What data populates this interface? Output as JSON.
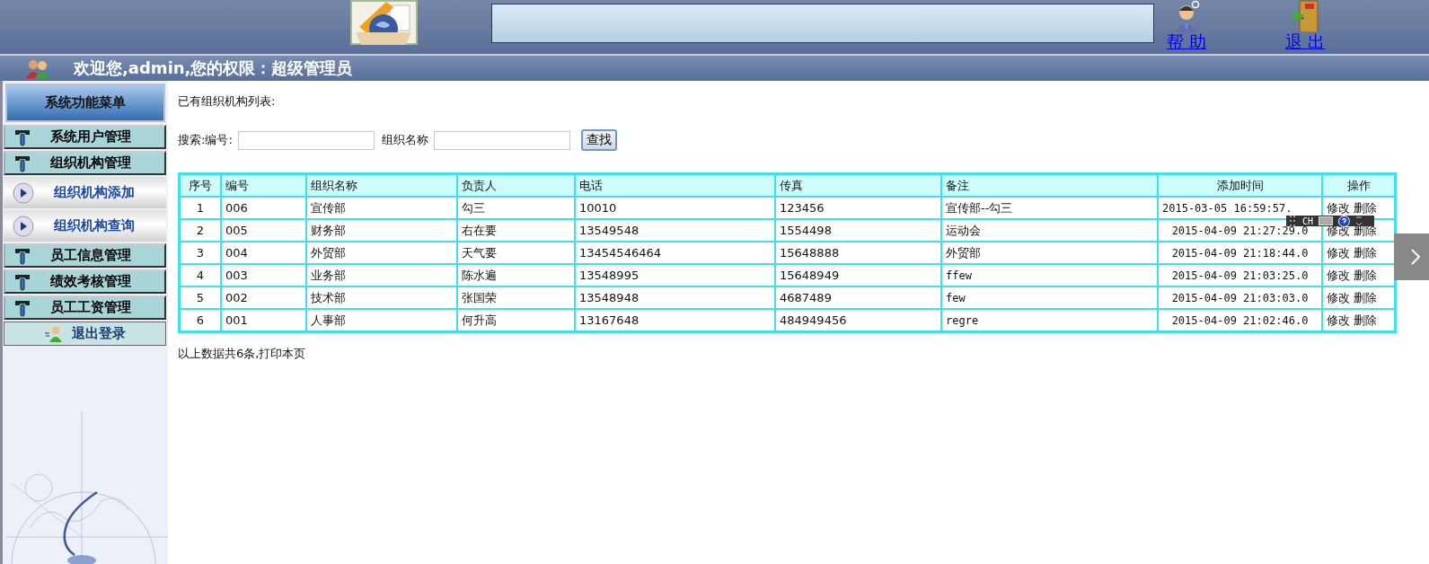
{
  "header": {
    "help_link": "帮 助",
    "exit_link": "退 出"
  },
  "welcome": "欢迎您,admin,您的权限：超级管理员",
  "sidebar": {
    "title": "系统功能菜单",
    "items": [
      {
        "label": "系统用户管理",
        "kind": "group"
      },
      {
        "label": "组织机构管理",
        "kind": "group"
      },
      {
        "label": "组织机构添加",
        "kind": "sub"
      },
      {
        "label": "组织机构查询",
        "kind": "sub"
      },
      {
        "label": "员工信息管理",
        "kind": "group"
      },
      {
        "label": "绩效考核管理",
        "kind": "group"
      },
      {
        "label": "员工工资管理",
        "kind": "group"
      },
      {
        "label": "退出登录",
        "kind": "logout"
      }
    ]
  },
  "content": {
    "heading": "已有组织机构列表:",
    "search": {
      "code_label": "搜索:编号:",
      "name_label": "组织名称",
      "button": "查找"
    },
    "table": {
      "columns": [
        "序号",
        "编号",
        "组织名称",
        "负责人",
        "电话",
        "传真",
        "备注",
        "添加时间",
        "操作"
      ],
      "rows": [
        {
          "cells": [
            "1",
            "006",
            "宣传部",
            "勾三",
            "10010",
            "123456",
            "宣传部--勾三",
            "2015-03-05 16:59:57."
          ],
          "actions": [
            "修改",
            "删除"
          ]
        },
        {
          "cells": [
            "2",
            "005",
            "财务部",
            "右在要",
            "13549548",
            "1554498",
            "运动会",
            "2015-04-09 21:27:29.0"
          ],
          "actions": [
            "修改",
            "删除"
          ]
        },
        {
          "cells": [
            "3",
            "004",
            "外贸部",
            "天气要",
            "13454546464",
            "15648888",
            "外贸部",
            "2015-04-09 21:18:44.0"
          ],
          "actions": [
            "修改",
            "删除"
          ]
        },
        {
          "cells": [
            "4",
            "003",
            "业务部",
            "陈水遍",
            "13548995",
            "15648949",
            "ffew",
            "2015-04-09 21:03:25.0"
          ],
          "actions": [
            "修改",
            "删除"
          ]
        },
        {
          "cells": [
            "5",
            "002",
            "技术部",
            "张国荣",
            "13548948",
            "4687489",
            "few",
            "2015-04-09 21:03:03.0"
          ],
          "actions": [
            "修改",
            "删除"
          ]
        },
        {
          "cells": [
            "6",
            "001",
            "人事部",
            "何升高",
            "13167648",
            "484949456",
            "regre",
            "2015-04-09 21:02:46.0"
          ],
          "actions": [
            "修改",
            "删除"
          ]
        }
      ]
    },
    "footer": "以上数据共6条,打印本页"
  },
  "ime_toolbar": {
    "label": "CH"
  }
}
